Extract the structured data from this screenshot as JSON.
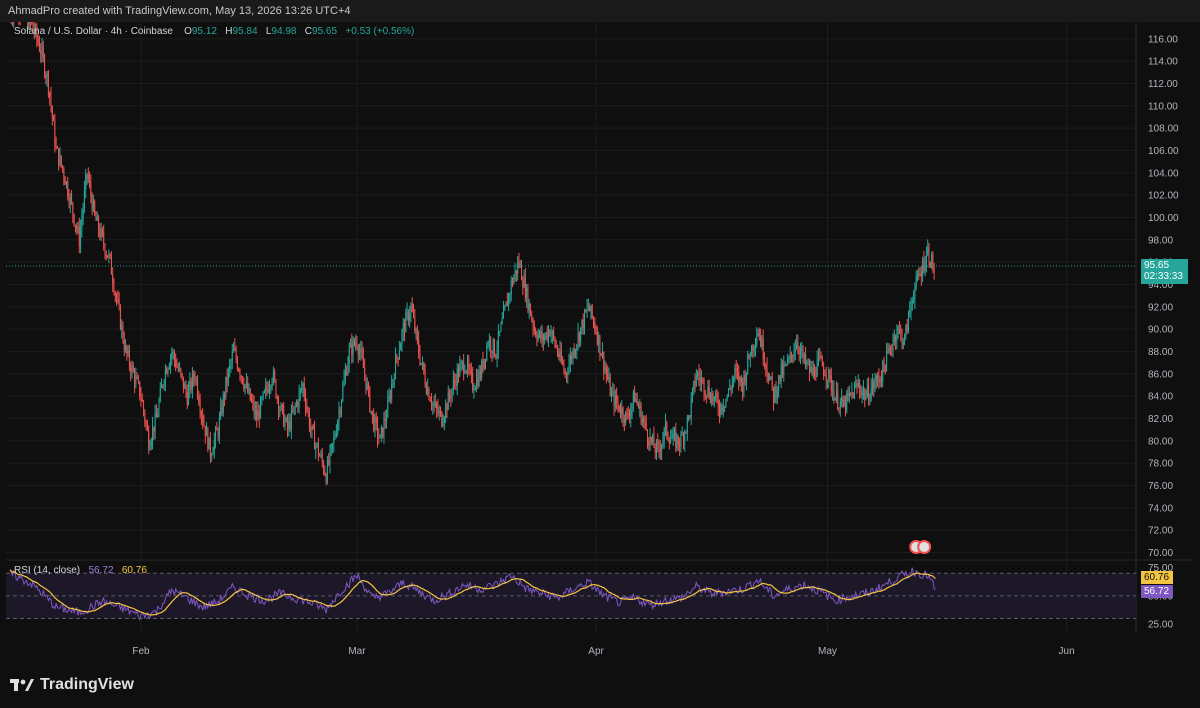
{
  "header": {
    "credit": "AhmadPro created with TradingView.com, May 13, 2026 13:26 UTC+4"
  },
  "legend": {
    "symbol": "Solana / U.S. Dollar · 4h · Coinbase",
    "o_label": "O",
    "o_value": "95.12",
    "h_label": "H",
    "h_value": "95.84",
    "l_label": "L",
    "l_value": "94.98",
    "c_label": "C",
    "c_value": "95.65",
    "change": "+0.53 (+0.56%)"
  },
  "rsi_legend": {
    "label": "RSI (14, close)",
    "rsi_value": "56.72",
    "ma_value": "60.76"
  },
  "last_price": {
    "price": "95.65",
    "countdown": "02:33:33"
  },
  "rsi_tags": {
    "ma": "60.76",
    "rsi": "56.72"
  },
  "brand": {
    "name": "TradingView"
  },
  "colors": {
    "up": "#26a69a",
    "down": "#ef5350",
    "rsi_line": "#7e57c2",
    "rsi_ma": "#f5c542",
    "background": "#0f0f0f"
  },
  "chart_data": {
    "type": "candlestick",
    "title": "Solana / U.S. Dollar · 4h · Coinbase",
    "y_ticks": [
      "116.00",
      "114.00",
      "112.00",
      "110.00",
      "108.00",
      "106.00",
      "104.00",
      "102.00",
      "100.00",
      "98.00",
      "96.00",
      "94.00",
      "92.00",
      "90.00",
      "88.00",
      "86.00",
      "84.00",
      "82.00",
      "80.00",
      "78.00",
      "76.00",
      "74.00",
      "72.00",
      "70.00"
    ],
    "ylim": [
      69.5,
      117.5
    ],
    "x_ticks": [
      {
        "label": "Feb",
        "day": 1
      },
      {
        "label": "Mar",
        "day": 29
      },
      {
        "label": "Apr",
        "day": 60
      },
      {
        "label": "May",
        "day": 90
      },
      {
        "label": "Jun",
        "day": 121
      }
    ],
    "xlim": [
      -16.5,
      130
    ],
    "close_series": [
      {
        "day": -16,
        "close": 118
      },
      {
        "day": -15,
        "close": 119
      },
      {
        "day": -14,
        "close": 118
      },
      {
        "day": -13,
        "close": 117
      },
      {
        "day": -12,
        "close": 115
      },
      {
        "day": -11,
        "close": 112
      },
      {
        "day": -10,
        "close": 106
      },
      {
        "day": -9,
        "close": 104
      },
      {
        "day": -8,
        "close": 101
      },
      {
        "day": -7,
        "close": 98
      },
      {
        "day": -6,
        "close": 104
      },
      {
        "day": -5,
        "close": 100
      },
      {
        "day": -4,
        "close": 98
      },
      {
        "day": -3,
        "close": 96
      },
      {
        "day": -2,
        "close": 92
      },
      {
        "day": -1,
        "close": 88
      },
      {
        "day": 0,
        "close": 86
      },
      {
        "day": 1,
        "close": 84
      },
      {
        "day": 2,
        "close": 80
      },
      {
        "day": 3,
        "close": 82
      },
      {
        "day": 4,
        "close": 86
      },
      {
        "day": 5,
        "close": 88
      },
      {
        "day": 6,
        "close": 86
      },
      {
        "day": 7,
        "close": 84
      },
      {
        "day": 8,
        "close": 86
      },
      {
        "day": 9,
        "close": 82
      },
      {
        "day": 10,
        "close": 79
      },
      {
        "day": 11,
        "close": 81
      },
      {
        "day": 12,
        "close": 85
      },
      {
        "day": 13,
        "close": 88
      },
      {
        "day": 14,
        "close": 86
      },
      {
        "day": 15,
        "close": 84
      },
      {
        "day": 16,
        "close": 82
      },
      {
        "day": 17,
        "close": 84
      },
      {
        "day": 18,
        "close": 86
      },
      {
        "day": 19,
        "close": 83
      },
      {
        "day": 20,
        "close": 81
      },
      {
        "day": 21,
        "close": 83
      },
      {
        "day": 22,
        "close": 85
      },
      {
        "day": 23,
        "close": 81
      },
      {
        "day": 24,
        "close": 79
      },
      {
        "day": 25,
        "close": 77
      },
      {
        "day": 26,
        "close": 80
      },
      {
        "day": 27,
        "close": 84
      },
      {
        "day": 28,
        "close": 88
      },
      {
        "day": 29,
        "close": 89
      },
      {
        "day": 30,
        "close": 86
      },
      {
        "day": 31,
        "close": 82
      },
      {
        "day": 32,
        "close": 80
      },
      {
        "day": 33,
        "close": 83
      },
      {
        "day": 34,
        "close": 87
      },
      {
        "day": 35,
        "close": 90
      },
      {
        "day": 36,
        "close": 92
      },
      {
        "day": 37,
        "close": 88
      },
      {
        "day": 38,
        "close": 85
      },
      {
        "day": 39,
        "close": 83
      },
      {
        "day": 40,
        "close": 82
      },
      {
        "day": 41,
        "close": 84
      },
      {
        "day": 42,
        "close": 86
      },
      {
        "day": 43,
        "close": 87
      },
      {
        "day": 44,
        "close": 85
      },
      {
        "day": 45,
        "close": 86
      },
      {
        "day": 46,
        "close": 89
      },
      {
        "day": 47,
        "close": 88
      },
      {
        "day": 48,
        "close": 91
      },
      {
        "day": 49,
        "close": 94
      },
      {
        "day": 50,
        "close": 96
      },
      {
        "day": 51,
        "close": 93
      },
      {
        "day": 52,
        "close": 90
      },
      {
        "day": 53,
        "close": 89
      },
      {
        "day": 54,
        "close": 90
      },
      {
        "day": 55,
        "close": 88
      },
      {
        "day": 56,
        "close": 86
      },
      {
        "day": 57,
        "close": 88
      },
      {
        "day": 58,
        "close": 90
      },
      {
        "day": 59,
        "close": 92
      },
      {
        "day": 60,
        "close": 90
      },
      {
        "day": 61,
        "close": 87
      },
      {
        "day": 62,
        "close": 84
      },
      {
        "day": 63,
        "close": 83
      },
      {
        "day": 64,
        "close": 82
      },
      {
        "day": 65,
        "close": 84
      },
      {
        "day": 66,
        "close": 82
      },
      {
        "day": 67,
        "close": 80
      },
      {
        "day": 68,
        "close": 79
      },
      {
        "day": 69,
        "close": 81
      },
      {
        "day": 70,
        "close": 80
      },
      {
        "day": 71,
        "close": 80
      },
      {
        "day": 72,
        "close": 82
      },
      {
        "day": 73,
        "close": 86
      },
      {
        "day": 74,
        "close": 85
      },
      {
        "day": 75,
        "close": 84
      },
      {
        "day": 76,
        "close": 83
      },
      {
        "day": 77,
        "close": 84
      },
      {
        "day": 78,
        "close": 86
      },
      {
        "day": 79,
        "close": 85
      },
      {
        "day": 80,
        "close": 88
      },
      {
        "day": 81,
        "close": 90
      },
      {
        "day": 82,
        "close": 87
      },
      {
        "day": 83,
        "close": 84
      },
      {
        "day": 84,
        "close": 86
      },
      {
        "day": 85,
        "close": 87
      },
      {
        "day": 86,
        "close": 89
      },
      {
        "day": 87,
        "close": 87
      },
      {
        "day": 88,
        "close": 86
      },
      {
        "day": 89,
        "close": 87
      },
      {
        "day": 90,
        "close": 86
      },
      {
        "day": 91,
        "close": 84
      },
      {
        "day": 92,
        "close": 83
      },
      {
        "day": 93,
        "close": 84
      },
      {
        "day": 94,
        "close": 85
      },
      {
        "day": 95,
        "close": 84
      },
      {
        "day": 96,
        "close": 85
      },
      {
        "day": 97,
        "close": 86
      },
      {
        "day": 98,
        "close": 88
      },
      {
        "day": 99,
        "close": 90
      },
      {
        "day": 100,
        "close": 89
      },
      {
        "day": 101,
        "close": 93
      },
      {
        "day": 102,
        "close": 95
      },
      {
        "day": 103,
        "close": 97
      },
      {
        "day": 104,
        "close": 95
      }
    ],
    "rsi": {
      "ylim": [
        18,
        80
      ],
      "bands": [
        70,
        50,
        30
      ],
      "y_ticks": [
        "75.00",
        "50.00",
        "25.00"
      ],
      "rsi_series": [
        {
          "day": -16,
          "value": 70
        },
        {
          "day": -13,
          "value": 60
        },
        {
          "day": -10,
          "value": 40
        },
        {
          "day": -7,
          "value": 35
        },
        {
          "day": -4,
          "value": 45
        },
        {
          "day": -1,
          "value": 38
        },
        {
          "day": 1,
          "value": 32
        },
        {
          "day": 3,
          "value": 36
        },
        {
          "day": 5,
          "value": 55
        },
        {
          "day": 7,
          "value": 48
        },
        {
          "day": 9,
          "value": 40
        },
        {
          "day": 11,
          "value": 45
        },
        {
          "day": 13,
          "value": 58
        },
        {
          "day": 15,
          "value": 50
        },
        {
          "day": 17,
          "value": 46
        },
        {
          "day": 19,
          "value": 52
        },
        {
          "day": 21,
          "value": 48
        },
        {
          "day": 23,
          "value": 44
        },
        {
          "day": 25,
          "value": 38
        },
        {
          "day": 27,
          "value": 55
        },
        {
          "day": 29,
          "value": 68
        },
        {
          "day": 31,
          "value": 48
        },
        {
          "day": 33,
          "value": 52
        },
        {
          "day": 35,
          "value": 62
        },
        {
          "day": 37,
          "value": 54
        },
        {
          "day": 39,
          "value": 46
        },
        {
          "day": 41,
          "value": 52
        },
        {
          "day": 43,
          "value": 60
        },
        {
          "day": 45,
          "value": 56
        },
        {
          "day": 47,
          "value": 60
        },
        {
          "day": 49,
          "value": 68
        },
        {
          "day": 51,
          "value": 56
        },
        {
          "day": 53,
          "value": 52
        },
        {
          "day": 55,
          "value": 48
        },
        {
          "day": 57,
          "value": 56
        },
        {
          "day": 59,
          "value": 62
        },
        {
          "day": 61,
          "value": 50
        },
        {
          "day": 63,
          "value": 44
        },
        {
          "day": 65,
          "value": 48
        },
        {
          "day": 67,
          "value": 42
        },
        {
          "day": 69,
          "value": 46
        },
        {
          "day": 71,
          "value": 48
        },
        {
          "day": 73,
          "value": 58
        },
        {
          "day": 75,
          "value": 52
        },
        {
          "day": 77,
          "value": 54
        },
        {
          "day": 79,
          "value": 56
        },
        {
          "day": 81,
          "value": 64
        },
        {
          "day": 83,
          "value": 50
        },
        {
          "day": 85,
          "value": 56
        },
        {
          "day": 87,
          "value": 60
        },
        {
          "day": 89,
          "value": 54
        },
        {
          "day": 91,
          "value": 46
        },
        {
          "day": 93,
          "value": 50
        },
        {
          "day": 95,
          "value": 52
        },
        {
          "day": 97,
          "value": 58
        },
        {
          "day": 99,
          "value": 66
        },
        {
          "day": 101,
          "value": 72
        },
        {
          "day": 103,
          "value": 68
        },
        {
          "day": 104,
          "value": 56
        }
      ]
    }
  }
}
